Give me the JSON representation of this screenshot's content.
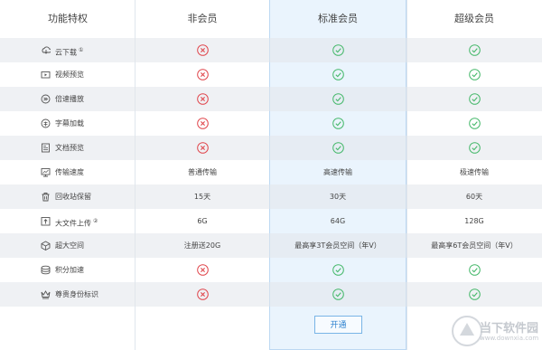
{
  "headers": {
    "feature": "功能特权",
    "non_member": "非会员",
    "standard": "标准会员",
    "super": "超级会员"
  },
  "rows": [
    {
      "label": "云下载",
      "badge": "①",
      "icon": "cloud-download-icon",
      "non_member": "no",
      "standard": "yes",
      "super": "yes"
    },
    {
      "label": "视频预览",
      "badge": "",
      "icon": "video-icon",
      "non_member": "no",
      "standard": "yes",
      "super": "yes"
    },
    {
      "label": "倍速播放",
      "badge": "",
      "icon": "speed-icon",
      "non_member": "no",
      "standard": "yes",
      "super": "yes"
    },
    {
      "label": "字幕加载",
      "badge": "",
      "icon": "subtitle-icon",
      "non_member": "no",
      "standard": "yes",
      "super": "yes"
    },
    {
      "label": "文档预览",
      "badge": "",
      "icon": "document-icon",
      "non_member": "no",
      "standard": "yes",
      "super": "yes"
    },
    {
      "label": "传输速度",
      "badge": "",
      "icon": "monitor-icon",
      "non_member": "普通传输",
      "standard": "高速传输",
      "super": "极速传输"
    },
    {
      "label": "回收站保留",
      "badge": "",
      "icon": "recycle-bin-icon",
      "non_member": "15天",
      "standard": "30天",
      "super": "60天"
    },
    {
      "label": "大文件上传",
      "badge": "②",
      "icon": "upload-icon",
      "non_member": "6G",
      "standard": "64G",
      "super": "128G"
    },
    {
      "label": "超大空间",
      "badge": "",
      "icon": "box-icon",
      "non_member": "注册送20G",
      "standard": "最高享3T会员空间（年V）",
      "super": "最高享6T会员空间（年V）"
    },
    {
      "label": "积分加速",
      "badge": "",
      "icon": "points-icon",
      "non_member": "no",
      "standard": "yes",
      "super": "yes"
    },
    {
      "label": "尊贵身份标识",
      "badge": "",
      "icon": "crown-icon",
      "non_member": "no",
      "standard": "yes",
      "super": "yes"
    }
  ],
  "button": {
    "open_label": "开通"
  },
  "watermark": {
    "text": "当下软件园",
    "url": "www.downxia.com"
  },
  "colors": {
    "yes": "#45b86a",
    "no": "#e0464c",
    "accent": "#2e82cf"
  }
}
